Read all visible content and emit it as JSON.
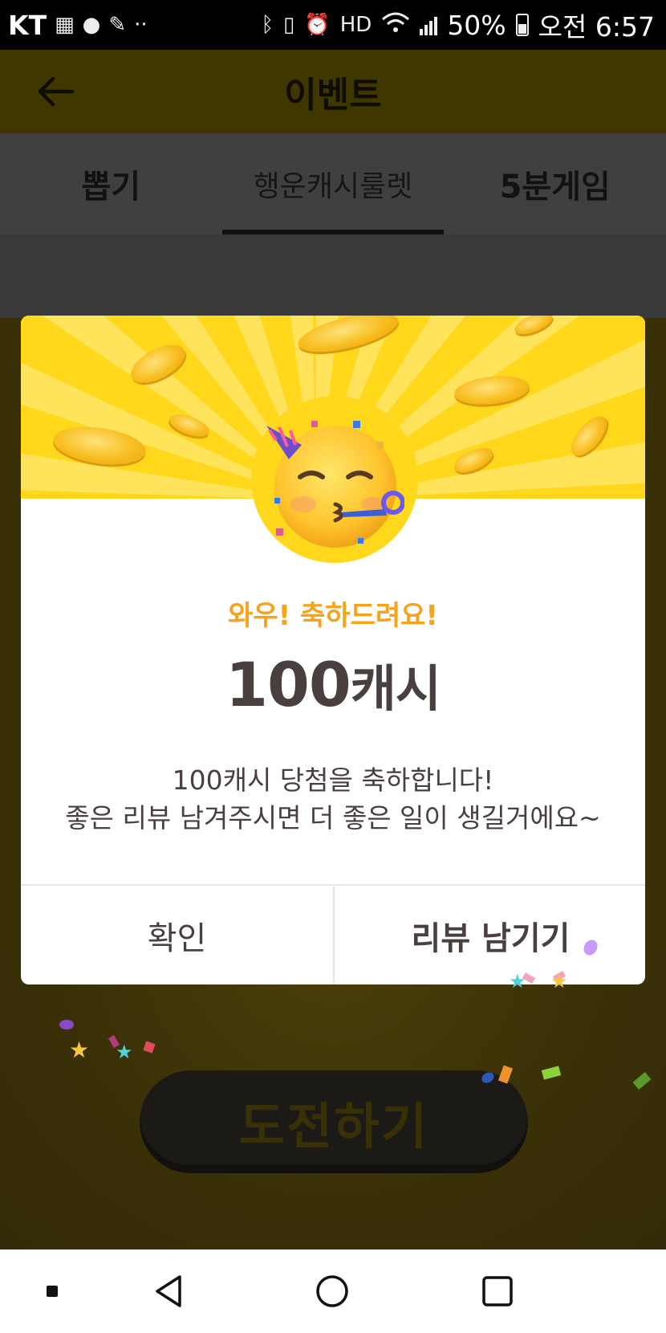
{
  "status_bar": {
    "carrier": "KT",
    "battery": "50%",
    "time": "오전 6:57"
  },
  "header": {
    "title": "이벤트"
  },
  "tabs": [
    {
      "label": "뽑기"
    },
    {
      "label": "행운캐시룰렛"
    },
    {
      "label": "5분게임"
    }
  ],
  "background": {
    "challenge_label": "도전하기"
  },
  "modal": {
    "congrats": "와우! 축하드려요!",
    "prize_amount": "100",
    "prize_unit": "캐시",
    "body_line1": "100캐시 당첨을 축하합니다!",
    "body_line2": "좋은 리뷰 남겨주시면 더 좋은 일이 생길거에요~",
    "confirm_label": "확인",
    "review_label": "리뷰 남기기"
  },
  "colors": {
    "accent": "#f7a21b",
    "banner": "#ffd81c",
    "text": "#4a3f3f"
  }
}
